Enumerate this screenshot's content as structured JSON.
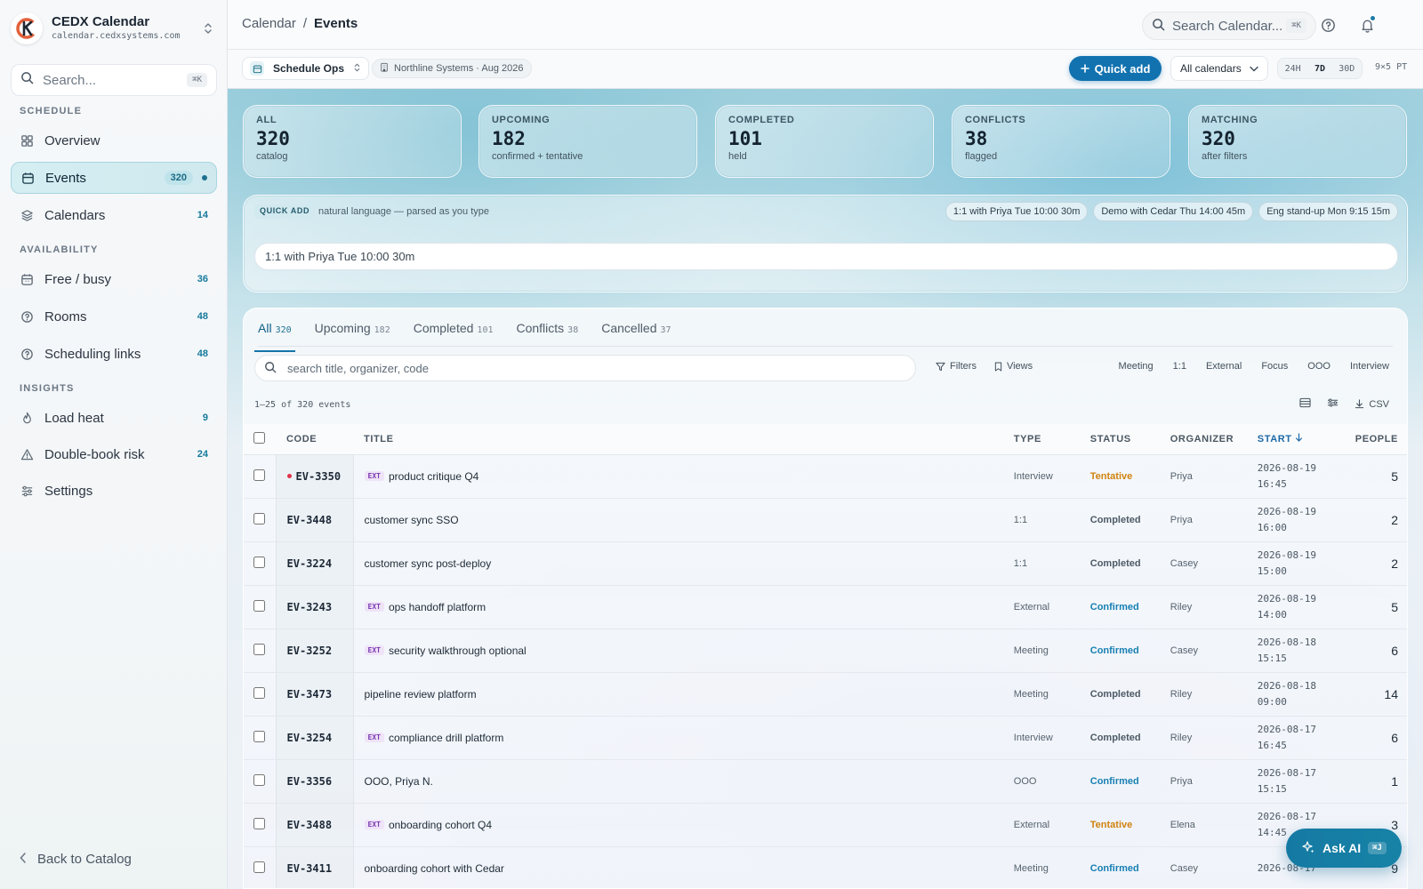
{
  "app": {
    "name": "CEDX Calendar",
    "domain": "calendar.cedxsystems.com",
    "accent_color": "#1272b0"
  },
  "sidebar": {
    "search_placeholder": "Search...",
    "search_shortcut": "⌘K",
    "sections": {
      "schedule": "SCHEDULE",
      "availability": "AVAILABILITY",
      "insights": "INSIGHTS"
    },
    "items": [
      {
        "label": "Overview",
        "count": "",
        "icon": "grid-icon"
      },
      {
        "label": "Events",
        "count": "320",
        "icon": "calendar-icon",
        "active": true
      },
      {
        "label": "Calendars",
        "count": "14",
        "icon": "layers-icon"
      },
      {
        "label": "Free / busy",
        "count": "36",
        "icon": "calendar-grid-icon"
      },
      {
        "label": "Rooms",
        "count": "48",
        "icon": "help-circle-icon"
      },
      {
        "label": "Scheduling links",
        "count": "48",
        "icon": "help-circle-icon"
      },
      {
        "label": "Load heat",
        "count": "9",
        "icon": "flame-icon"
      },
      {
        "label": "Double-book risk",
        "count": "24",
        "icon": "warning-icon"
      },
      {
        "label": "Settings",
        "count": "",
        "icon": "sliders-icon"
      }
    ],
    "back_label": "Back to Catalog"
  },
  "topbar": {
    "breadcrumb_root": "Calendar",
    "breadcrumb_sep": "/",
    "breadcrumb_current": "Events",
    "search_placeholder": "Search Calendar...",
    "search_shortcut": "⌘K"
  },
  "subbar": {
    "workspace": "Schedule Ops",
    "org_chip": "Northline Systems · Aug 2026",
    "quick_add": "Quick add",
    "calendar_filter": "All calendars",
    "ranges": [
      "24H",
      "7D",
      "30D"
    ],
    "active_range": "7D",
    "timezone": "9×5 PT"
  },
  "stats": [
    {
      "label": "ALL",
      "value": "320",
      "sub": "catalog"
    },
    {
      "label": "UPCOMING",
      "value": "182",
      "sub": "confirmed + tentative"
    },
    {
      "label": "COMPLETED",
      "value": "101",
      "sub": "held"
    },
    {
      "label": "CONFLICTS",
      "value": "38",
      "sub": "flagged"
    },
    {
      "label": "MATCHING",
      "value": "320",
      "sub": "after filters"
    }
  ],
  "quick_add": {
    "badge": "QUICK ADD",
    "hint": "natural language — parsed as you type",
    "examples": [
      "1:1 with Priya Tue 10:00 30m",
      "Demo with Cedar Thu 14:00 45m",
      "Eng stand-up Mon 9:15 15m"
    ],
    "input_value": "1:1 with Priya Tue 10:00 30m"
  },
  "tabs": [
    {
      "label": "All",
      "count": "320",
      "active": true
    },
    {
      "label": "Upcoming",
      "count": "182"
    },
    {
      "label": "Completed",
      "count": "101"
    },
    {
      "label": "Conflicts",
      "count": "38"
    },
    {
      "label": "Cancelled",
      "count": "37"
    }
  ],
  "table_toolbar": {
    "search_placeholder": "search title, organizer, code",
    "filters": "Filters",
    "views": "Views",
    "type_chips": [
      "Meeting",
      "1:1",
      "External",
      "Focus",
      "OOO",
      "Interview"
    ],
    "range_info": "1–25 of 320 events",
    "csv": "CSV"
  },
  "columns": {
    "code": "CODE",
    "title": "TITLE",
    "type": "TYPE",
    "status": "STATUS",
    "organizer": "ORGANIZER",
    "start": "START",
    "people": "PEOPLE"
  },
  "rows": [
    {
      "code": "EV-3350",
      "live": true,
      "ext": true,
      "title": "product critique Q4",
      "type": "Interview",
      "status": "Tentative",
      "organizer": "Priya",
      "date": "2026-08-19",
      "time": "16:45",
      "people": "5"
    },
    {
      "code": "EV-3448",
      "live": false,
      "ext": false,
      "title": "customer sync SSO",
      "type": "1:1",
      "status": "Completed",
      "organizer": "Priya",
      "date": "2026-08-19",
      "time": "16:00",
      "people": "2"
    },
    {
      "code": "EV-3224",
      "live": false,
      "ext": false,
      "title": "customer sync post-deploy",
      "type": "1:1",
      "status": "Completed",
      "organizer": "Casey",
      "date": "2026-08-19",
      "time": "15:00",
      "people": "2"
    },
    {
      "code": "EV-3243",
      "live": false,
      "ext": true,
      "title": "ops handoff platform",
      "type": "External",
      "status": "Confirmed",
      "organizer": "Riley",
      "date": "2026-08-19",
      "time": "14:00",
      "people": "5"
    },
    {
      "code": "EV-3252",
      "live": false,
      "ext": true,
      "title": "security walkthrough optional",
      "type": "Meeting",
      "status": "Confirmed",
      "organizer": "Casey",
      "date": "2026-08-18",
      "time": "15:15",
      "people": "6"
    },
    {
      "code": "EV-3473",
      "live": false,
      "ext": false,
      "title": "pipeline review platform",
      "type": "Meeting",
      "status": "Completed",
      "organizer": "Riley",
      "date": "2026-08-18",
      "time": "09:00",
      "people": "14"
    },
    {
      "code": "EV-3254",
      "live": false,
      "ext": true,
      "title": "compliance drill platform",
      "type": "Interview",
      "status": "Completed",
      "organizer": "Riley",
      "date": "2026-08-17",
      "time": "16:45",
      "people": "6"
    },
    {
      "code": "EV-3356",
      "live": false,
      "ext": false,
      "title": "OOO, Priya N.",
      "type": "OOO",
      "status": "Confirmed",
      "organizer": "Priya",
      "date": "2026-08-17",
      "time": "15:15",
      "people": "1"
    },
    {
      "code": "EV-3488",
      "live": false,
      "ext": true,
      "title": "onboarding cohort Q4",
      "type": "External",
      "status": "Tentative",
      "organizer": "Elena",
      "date": "2026-08-17",
      "time": "14:45",
      "people": "3"
    },
    {
      "code": "EV-3411",
      "live": false,
      "ext": false,
      "title": "onboarding cohort with Cedar",
      "type": "Meeting",
      "status": "Confirmed",
      "organizer": "Casey",
      "date": "2026-08-17",
      "time": "",
      "people": "9"
    }
  ],
  "ext_tag": "EXT",
  "ask_ai": {
    "label": "Ask AI",
    "shortcut": "⌘J"
  }
}
